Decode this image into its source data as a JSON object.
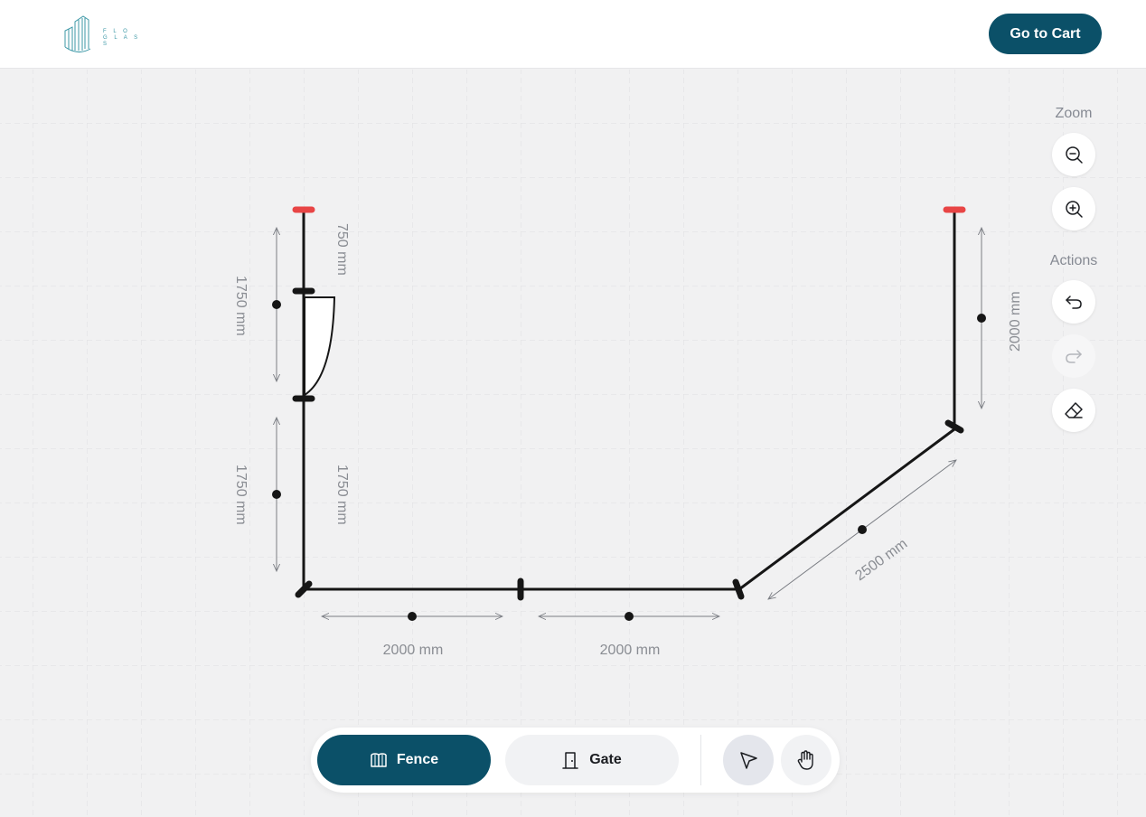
{
  "header": {
    "logo_text_line1": "F L O",
    "logo_text_line2": "G L A S S",
    "cart_button": "Go to Cart"
  },
  "side_panel": {
    "zoom_label": "Zoom",
    "actions_label": "Actions",
    "buttons": [
      {
        "name": "zoom-out",
        "icon": "zoom-out-icon"
      },
      {
        "name": "zoom-in",
        "icon": "zoom-in-icon"
      },
      {
        "name": "undo",
        "icon": "undo-icon"
      },
      {
        "name": "redo",
        "icon": "redo-icon",
        "disabled": true
      },
      {
        "name": "eraser",
        "icon": "eraser-icon"
      }
    ]
  },
  "drawing": {
    "dimensions": {
      "left_gap": "750 mm",
      "left_gate": "1750 mm",
      "left_lower_outer": "1750 mm",
      "left_lower_inner": "1750 mm",
      "bottom_left": "2000 mm",
      "bottom_right": "2000 mm",
      "diagonal": "2500 mm",
      "right": "2000 mm"
    }
  },
  "toolbar": {
    "fence_label": "Fence",
    "gate_label": "Gate",
    "active_tool": "select"
  },
  "colors": {
    "primary": "#0b5068",
    "endpoint": "#e84545",
    "line": "#161616",
    "dimension": "#8a8d93"
  }
}
